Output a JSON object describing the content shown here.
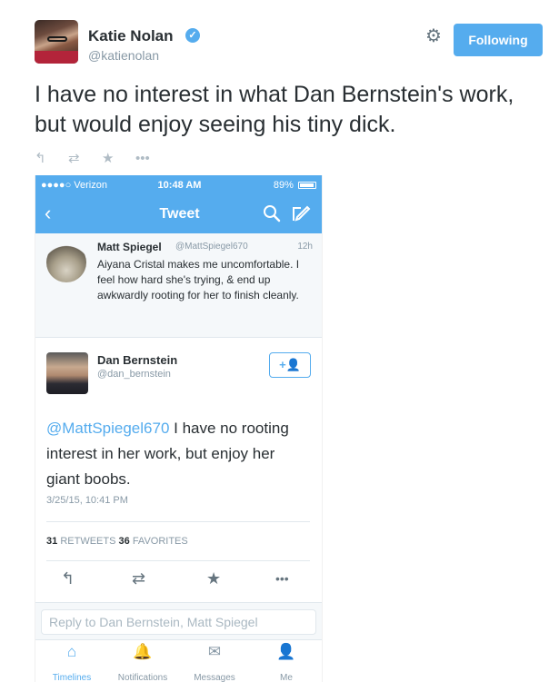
{
  "tweet": {
    "author_name": "Katie Nolan",
    "author_handle": "@katienolan",
    "follow_label": "Following",
    "text": "I have no interest in what Dan Bernstein's work, but would enjoy seeing his tiny dick."
  },
  "phone": {
    "status": {
      "carrier": "●●●●○ Verizon",
      "time": "10:48 AM",
      "battery": "89%"
    },
    "nav_title": "Tweet",
    "quoted": {
      "name": "Matt Spiegel",
      "handle": "@MattSpiegel670",
      "time": "12h",
      "text": "Aiyana Cristal makes me uncomfortable. I feel how hard she's trying, & end up awkwardly rooting for her to finish cleanly."
    },
    "main": {
      "name": "Dan Bernstein",
      "handle": "@dan_bernstein",
      "mention": "@MattSpiegel670",
      "text": " I have no rooting interest in her work, but enjoy her giant boobs.",
      "timestamp": "3/25/15, 10:41 PM",
      "retweets": "31",
      "retweets_label": "RETWEETS",
      "favorites": "36",
      "favorites_label": "FAVORITES"
    },
    "reply_placeholder": "Reply to Dan Bernstein, Matt Spiegel",
    "tabs": [
      {
        "label": "Timelines",
        "icon": "home-icon"
      },
      {
        "label": "Notifications",
        "icon": "bell-icon"
      },
      {
        "label": "Messages",
        "icon": "envelope-icon"
      },
      {
        "label": "Me",
        "icon": "person-icon"
      }
    ]
  },
  "colors": {
    "accent": "#55acee",
    "text": "#292f33",
    "muted": "#8899a6"
  }
}
